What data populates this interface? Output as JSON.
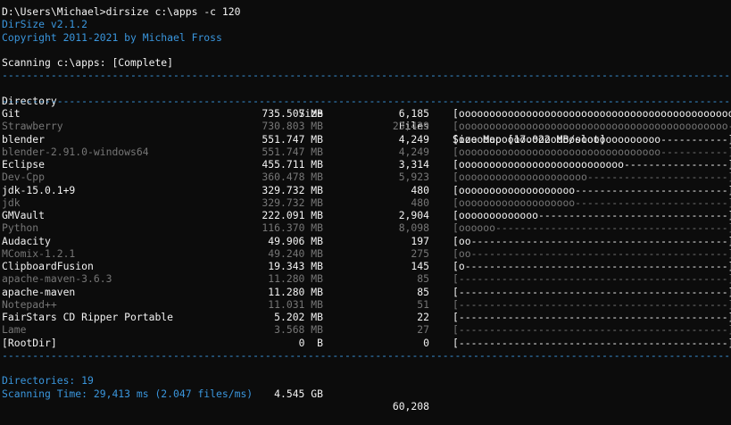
{
  "command": {
    "prompt": "D:\\Users\\Michael>",
    "input": "dirsize c:\\apps -c 120"
  },
  "banner": {
    "app": "DirSize v2.1.2",
    "copyright": "Copyright 2011-2021 by Michael Fross"
  },
  "scan_status": "Scanning c:\\apps: [Complete]",
  "separator": "------------------------------------------------------------------------------------------------------------------------",
  "header": {
    "directory": "Directory",
    "size": "Size",
    "files": "Files",
    "size_map": "Size Map [17.022 MB/slot]"
  },
  "rows": [
    {
      "dir": "Git",
      "size": "735.507 MB",
      "files": "6,185",
      "map": "[ooooooooooooooooooooooooooooooooooooooooooooo]",
      "style": "bright"
    },
    {
      "dir": "Strawberry",
      "size": "730.803 MB",
      "files": "23,439",
      "map": "[oooooooooooooooooooooooooooooooooooooooooooo-]",
      "style": "dim"
    },
    {
      "dir": "blender",
      "size": "551.747 MB",
      "files": "4,249",
      "map": "[ooooooooooooooooooooooooooooooooo-----------]",
      "style": "bright"
    },
    {
      "dir": "blender-2.91.0-windows64",
      "size": "551.747 MB",
      "files": "4,249",
      "map": "[ooooooooooooooooooooooooooooooooo-----------]",
      "style": "dim"
    },
    {
      "dir": "Eclipse",
      "size": "455.711 MB",
      "files": "3,314",
      "map": "[ooooooooooooooooooooooooooo-----------------]",
      "style": "bright"
    },
    {
      "dir": "Dev-Cpp",
      "size": "360.478 MB",
      "files": "5,923",
      "map": "[ooooooooooooooooooooo-----------------------]",
      "style": "dim"
    },
    {
      "dir": "jdk-15.0.1+9",
      "size": "329.732 MB",
      "files": "480",
      "map": "[ooooooooooooooooooo-------------------------]",
      "style": "bright"
    },
    {
      "dir": "jdk",
      "size": "329.732 MB",
      "files": "480",
      "map": "[ooooooooooooooooooo-------------------------]",
      "style": "dim"
    },
    {
      "dir": "GMVault",
      "size": "222.091 MB",
      "files": "2,904",
      "map": "[ooooooooooooo-------------------------------]",
      "style": "bright"
    },
    {
      "dir": "Python",
      "size": "116.370 MB",
      "files": "8,098",
      "map": "[oooooo--------------------------------------]",
      "style": "dim"
    },
    {
      "dir": "Audacity",
      "size": "49.906 MB",
      "files": "197",
      "map": "[oo------------------------------------------]",
      "style": "bright"
    },
    {
      "dir": "MComix-1.2.1",
      "size": "49.240 MB",
      "files": "275",
      "map": "[oo------------------------------------------]",
      "style": "dim"
    },
    {
      "dir": "ClipboardFusion",
      "size": "19.343 MB",
      "files": "145",
      "map": "[o-------------------------------------------]",
      "style": "bright"
    },
    {
      "dir": "apache-maven-3.6.3",
      "size": "11.280 MB",
      "files": "85",
      "map": "[--------------------------------------------]",
      "style": "dim"
    },
    {
      "dir": "apache-maven",
      "size": "11.280 MB",
      "files": "85",
      "map": "[--------------------------------------------]",
      "style": "bright"
    },
    {
      "dir": "Notepad++",
      "size": "11.031 MB",
      "files": "51",
      "map": "[--------------------------------------------]",
      "style": "dim"
    },
    {
      "dir": "FairStars CD Ripper Portable",
      "size": "5.202 MB",
      "files": "22",
      "map": "[--------------------------------------------]",
      "style": "bright"
    },
    {
      "dir": "Lame",
      "size": "3.568 MB",
      "files": "27",
      "map": "[--------------------------------------------]",
      "style": "dim"
    },
    {
      "dir": "[RootDir]",
      "size": "0  B",
      "files": "0",
      "map": "[--------------------------------------------]",
      "style": "bright"
    }
  ],
  "summary": {
    "label": "Directories: 19",
    "size": "4.545 GB",
    "files": "60,208"
  },
  "scan_time": "Scanning Time: 29,413 ms (2.047 files/ms)",
  "colors": {
    "background": "#0c0c0c",
    "cyan": "#3a96dd",
    "bright": "#f2f2f2",
    "dim": "#767676",
    "text": "#cccccc"
  }
}
